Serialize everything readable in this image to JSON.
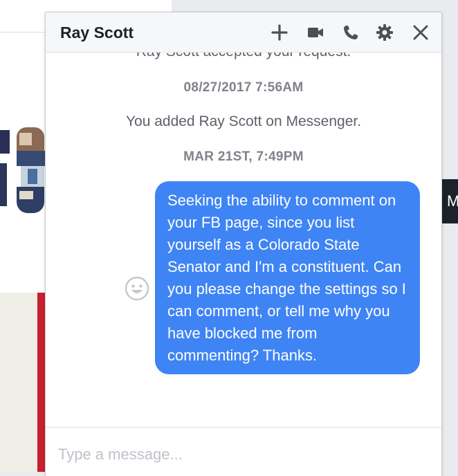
{
  "chat": {
    "title": "Ray Scott",
    "header_icons": [
      "plus-icon",
      "video-camera-icon",
      "phone-icon",
      "gear-icon",
      "close-icon"
    ],
    "messages": {
      "system_partial": "Ray Scott accepted your request.",
      "date_1": "08/27/2017 7:56AM",
      "system_added": "You added Ray Scott on Messenger.",
      "date_2": "MAR 21ST, 7:49PM",
      "outgoing_text": "Seeking the ability to comment on your FB page, since you list yourself as a Colorado State Senator and I'm a constituent. Can you please change the settings so I can comment, or tell me why you have blocked me from commenting? Thanks."
    },
    "composer": {
      "placeholder": "Type a message...",
      "value": ""
    }
  },
  "tooltip": {
    "text": "M"
  },
  "colors": {
    "bubble": "#3f84f4",
    "header_bg": "#f6f7f9",
    "page_bg": "#e9ebee",
    "icon_gray": "#4b4f56",
    "accent_red": "#c8202f"
  }
}
